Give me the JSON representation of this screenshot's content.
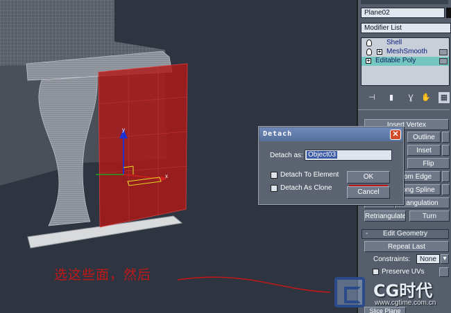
{
  "viewport": {
    "gizmo": {
      "axis_x": "x",
      "axis_y": "y"
    },
    "caption": "选这些面，然后"
  },
  "panel": {
    "object_name": "Plane02",
    "modifier_list": "Modifier List",
    "stack": [
      {
        "label": "Shell",
        "icon": "lightbulb-icon"
      },
      {
        "label": "MeshSmooth",
        "icon": "lightbulb-icon"
      },
      {
        "label": "Editable Poly",
        "icon": "plus-icon"
      }
    ],
    "tool_icons": [
      "pin-icon",
      "bar-icon",
      "fork-icon",
      "hand-icon",
      "configure-icon"
    ],
    "edit_elements": {
      "insert_vertex": "Insert Vertex",
      "outline": "Outline",
      "inset": "Inset",
      "flip": "Flip",
      "from_edge": "om Edge",
      "along_spline": "long Spline",
      "triangulation": "angulation",
      "retriangulate": "Retriangulate",
      "turn": "Turn"
    },
    "edit_geometry": {
      "title": "Edit Geometry",
      "collapse_mark": "-",
      "repeat_last": "Repeat Last",
      "constraints_label": "Constraints:",
      "constraints_value": "None",
      "preserve_uvs": "Preserve UVs",
      "slice_plane": "Slice Plane"
    }
  },
  "dialog": {
    "title": "Detach",
    "close_glyph": "✕",
    "detach_as_label": "Detach as:",
    "detach_as_value": "Object03",
    "detach_to_element": "Detach To Element",
    "detach_as_clone": "Detach As Clone",
    "ok": "OK",
    "cancel": "Cancel"
  },
  "watermark": {
    "brand": "CG时代",
    "url": "www.cgtime.com.cn"
  },
  "colors": {
    "selection_red": "#b01818",
    "stack_highlight": "#74c7c0",
    "dialog_title": "#6e89b8"
  }
}
